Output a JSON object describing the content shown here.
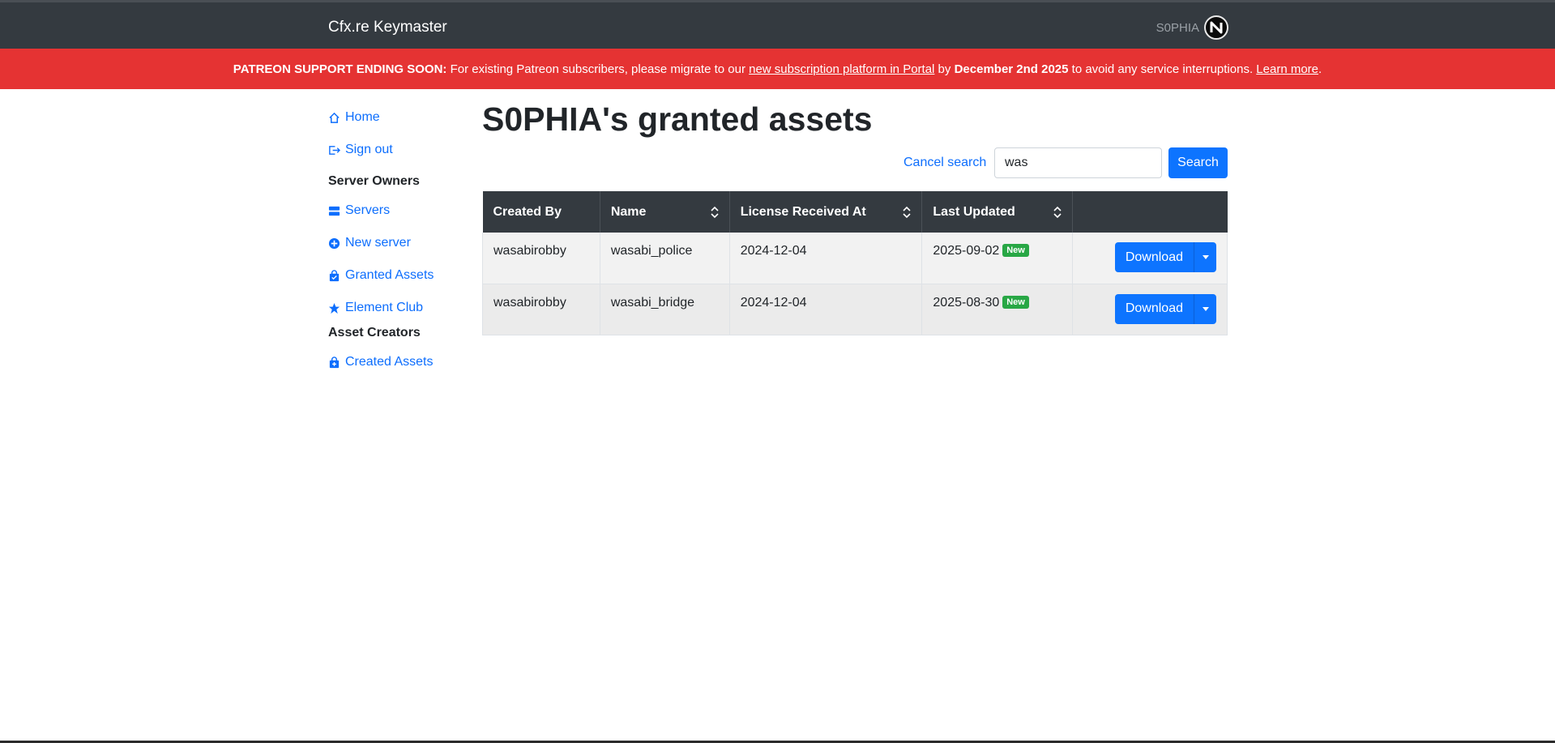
{
  "app": {
    "brand": "Cfx.re Keymaster",
    "user_name": "S0PHIA"
  },
  "banner": {
    "strong": "PATREON SUPPORT ENDING SOON:",
    "text1": " For existing Patreon subscribers, please migrate to our ",
    "link1": "new subscription platform in Portal",
    "text2": " by ",
    "date": "December 2nd 2025",
    "text3": " to avoid any service interruptions. ",
    "link2": "Learn more",
    "end": "."
  },
  "sidebar": {
    "home": "Home",
    "sign_out": "Sign out",
    "server_owners": "Server Owners",
    "servers": "Servers",
    "new_server": "New server",
    "granted_assets": "Granted Assets",
    "element_club": "Element Club",
    "asset_creators": "Asset Creators",
    "created_assets": "Created Assets"
  },
  "main": {
    "title": "S0PHIA's granted assets",
    "cancel_search": "Cancel search",
    "search_value": "was",
    "search_button": "Search"
  },
  "table": {
    "headers": [
      "Created By",
      "Name",
      "License Received At",
      "Last Updated",
      ""
    ],
    "rows": [
      {
        "created_by": "wasabirobby",
        "name": "wasabi_police",
        "license": "2024-12-04",
        "updated": "2025-09-02",
        "badge": "New",
        "action": "Download"
      },
      {
        "created_by": "wasabirobby",
        "name": "wasabi_bridge",
        "license": "2024-12-04",
        "updated": "2025-08-30",
        "badge": "New",
        "action": "Download"
      }
    ]
  },
  "colors": {
    "navbar": "#343a40",
    "banner": "#e53333",
    "primary": "#0d74ff",
    "badge": "#28a745"
  },
  "icons": [
    "home-icon",
    "sign-out-icon",
    "servers-icon",
    "plus-circle-icon",
    "bag-icon",
    "star-icon",
    "bag-plus-icon",
    "sort-icon",
    "caret-down-icon",
    "avatar-logo-icon"
  ]
}
